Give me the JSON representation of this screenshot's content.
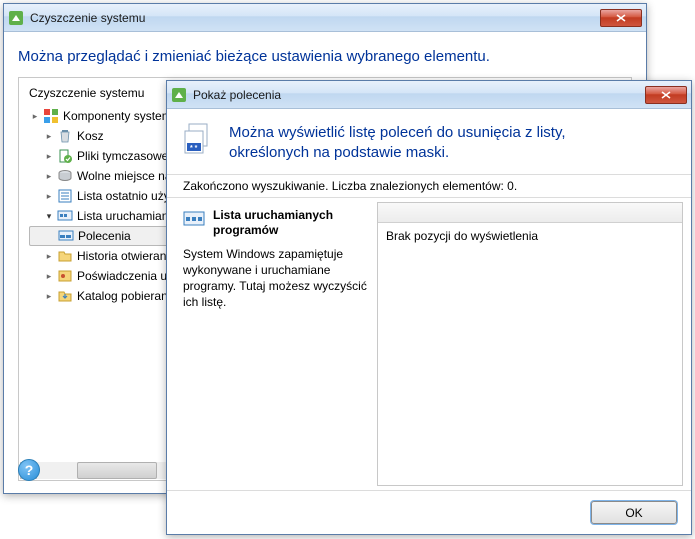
{
  "window1": {
    "title": "Czyszczenie systemu",
    "banner": "Można przeglądać i zmieniać bieżące ustawienia wybranego elementu.",
    "panel_title": "Czyszczenie systemu",
    "tree": {
      "root": "Komponenty systemowe",
      "items": [
        "Kosz",
        "Pliki tymczasowe",
        "Wolne miejsce na",
        "Lista ostatnio uży",
        "Lista uruchamiany",
        "Polecenia",
        "Historia otwierany",
        "Poświadczenia uży",
        "Katalog pobierania"
      ]
    }
  },
  "window2": {
    "title": "Pokaż polecenia",
    "header_line1": "Można wyświetlić listę poleceń do usunięcia z listy,",
    "header_line2": "określonych na podstawie maski.",
    "status": "Zakończono wyszukiwanie. Liczba znalezionych elementów: 0.",
    "left_title": "Lista uruchamianych programów",
    "left_desc": "System Windows zapamiętuje wykonywane i uruchamiane programy. Tutaj możesz wyczyścić ich listę.",
    "right_empty": "Brak pozycji do wyświetlenia",
    "ok_label": "OK"
  }
}
